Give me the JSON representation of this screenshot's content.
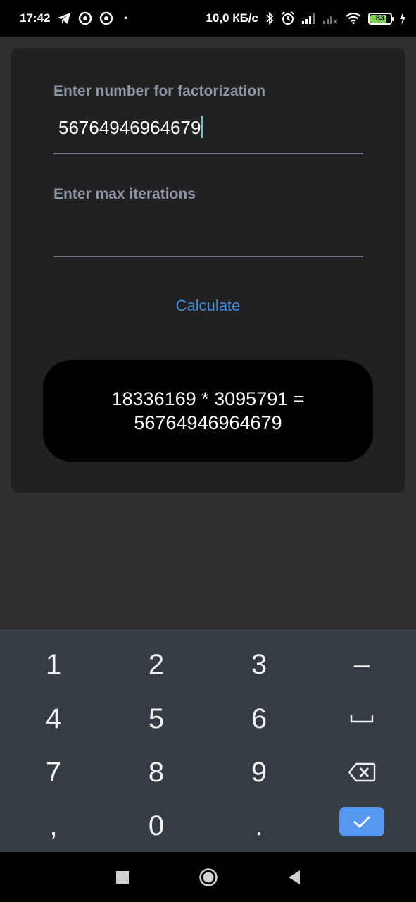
{
  "status_bar": {
    "time": "17:42",
    "network_speed": "10,0 КБ/с",
    "battery_level": "83",
    "battery_fraction": 0.83,
    "icons": [
      "telegram-icon",
      "app-notification-icon",
      "app-notification-icon",
      "dot-icon",
      "bluetooth-icon",
      "alarm-icon",
      "signal-icon",
      "signal-no-service-icon",
      "wifi-icon",
      "battery-icon",
      "charging-icon"
    ]
  },
  "form": {
    "number_label": "Enter number for factorization",
    "number_value": "56764946964679",
    "iterations_label": "Enter max iterations",
    "iterations_value": "",
    "calculate_label": "Calculate"
  },
  "result": {
    "line1": "18336169 * 3095791 =",
    "line2": "56764946964679"
  },
  "keyboard": {
    "keys": [
      "1",
      "2",
      "3",
      "−",
      "4",
      "5",
      "6",
      "space",
      "7",
      "8",
      "9",
      "backspace",
      ",",
      "0",
      ".",
      "enter"
    ],
    "labels": {
      "k1": "1",
      "k2": "2",
      "k3": "3",
      "minus": "–",
      "k4": "4",
      "k5": "5",
      "k6": "6",
      "k7": "7",
      "k8": "8",
      "k9": "9",
      "comma": ",",
      "k0": "0",
      "dot": "."
    },
    "accent_color": "#5797f4"
  },
  "navigation": [
    "recent-apps-icon",
    "home-icon",
    "back-icon"
  ]
}
